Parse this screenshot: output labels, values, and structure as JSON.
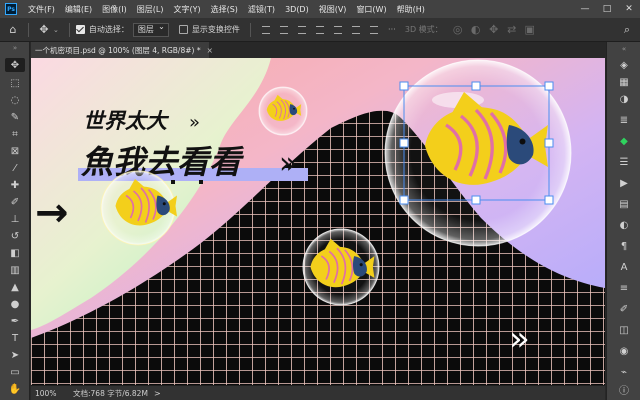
{
  "app": {
    "logo_text": "Ps"
  },
  "menu": [
    "文件(F)",
    "编辑(E)",
    "图像(I)",
    "图层(L)",
    "文字(Y)",
    "选择(S)",
    "滤镜(T)",
    "3D(D)",
    "视图(V)",
    "窗口(W)",
    "帮助(H)"
  ],
  "window_controls": {
    "minimize": "—",
    "maximize": "□",
    "close": "✕"
  },
  "options": {
    "auto_select_label": "自动选择：",
    "auto_select_checked": true,
    "auto_select_value": "图层",
    "transform_controls_label": "显示变换控件",
    "transform_controls_checked": false,
    "mode_3d_label": "3D 模式："
  },
  "document_tab": {
    "title": "一个机密项目.psd @ 100% (图层 4, RGB/8#) *",
    "close": "×"
  },
  "canvas": {
    "headline_1": "世界太大",
    "headline_2": "魚我去看看",
    "chevrons_small": "»",
    "chevrons_large": "»",
    "chevrons_bottom": "»",
    "arrow": "→"
  },
  "status": {
    "zoom": "100%",
    "doc_info": "文档:768 字节/6.82M",
    "chevron": ">"
  },
  "colors": {
    "fish_yellow": "#f3cf1b",
    "fish_stripes": "#e06fa6",
    "fish_face": "#2b4a7a",
    "grid_line": "#f0c7c0",
    "accent_blue": "#31a8ff",
    "active_green": "#2fd35e"
  }
}
